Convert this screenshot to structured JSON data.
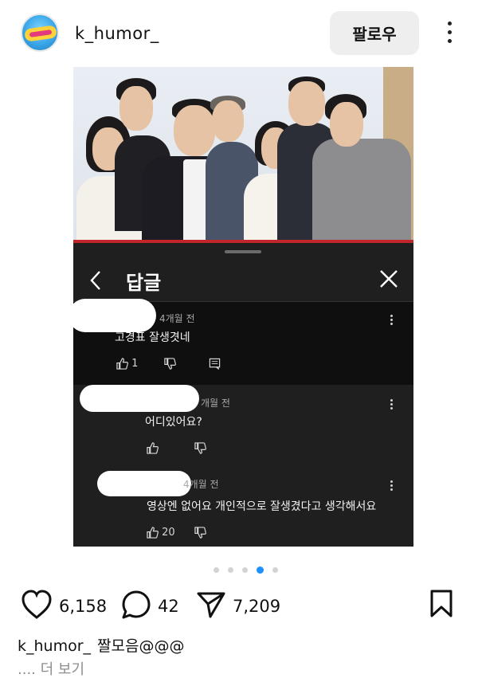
{
  "header": {
    "username": "k_humor_",
    "follow_label": "팔로우"
  },
  "post": {
    "panel": {
      "title": "답글",
      "comments": [
        {
          "time": "4개월 전",
          "text": "고경표   잘생겻네",
          "likes": "1"
        },
        {
          "time": "개월 전",
          "text": "어디있어요?",
          "likes": ""
        },
        {
          "time": "4개월 전",
          "text": "영상엔 없어요  개인적으로 잘생겼다고 생각해서요",
          "likes": "20"
        }
      ]
    },
    "carousel": {
      "count": 5,
      "active_index": 3
    }
  },
  "actions": {
    "likes": "6,158",
    "comments": "42",
    "shares": "7,209"
  },
  "caption": {
    "username": "k_humor_",
    "text": "짤모음@@@",
    "more": ".... 더 보기"
  },
  "colors": {
    "follow_bg": "#eeeeee",
    "panel_bg": "#1f1f1f",
    "active_dot": "#1e90ff",
    "photo_strip": "#c0262a"
  },
  "icons": [
    "heart-icon",
    "comment-icon",
    "share-icon",
    "bookmark-icon",
    "more-icon",
    "back-icon",
    "close-icon",
    "thumbs-up-icon",
    "thumbs-down-icon",
    "reply-icon"
  ]
}
